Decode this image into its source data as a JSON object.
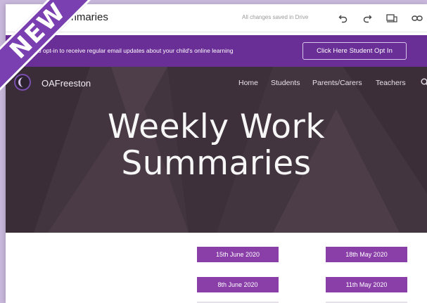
{
  "editor": {
    "title": "Summaries",
    "save_status": "All changes saved in Drive",
    "tools": [
      {
        "icon": "undo-icon"
      },
      {
        "icon": "redo-icon"
      },
      {
        "icon": "device-preview-icon"
      },
      {
        "icon": "link-icon"
      }
    ]
  },
  "banner": {
    "text": "hoose to opt-in to receive regular email updates about your child's online learning",
    "button_label": "Click Here Student Opt In",
    "color": "#6a2e97"
  },
  "site": {
    "name": "OAFreeston",
    "nav": [
      "Home",
      "Students",
      "Parents/Carers",
      "Teachers"
    ],
    "search_icon": "search-icon"
  },
  "hero": {
    "line1": "Weekly Work",
    "line2": "Summaries",
    "background": "#43353f"
  },
  "dates": {
    "left": [
      "15th June 2020",
      "8th June 2020"
    ],
    "right": [
      "18th May 2020",
      "11th May 2020"
    ],
    "button_color": "#8a3fa8"
  },
  "ribbon": {
    "text": "NEW",
    "color": "#7a3fb0"
  }
}
